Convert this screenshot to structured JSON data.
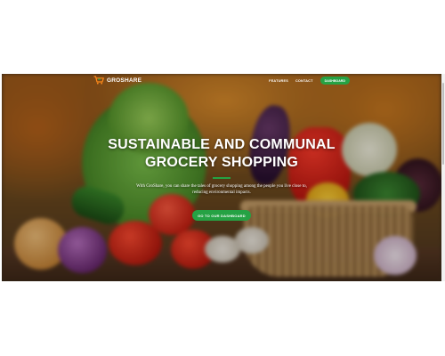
{
  "brand": {
    "name": "GROSHARE",
    "icon": "shopping-cart-icon",
    "accent": "#25a244"
  },
  "nav": {
    "links": [
      "FEATURES",
      "CONTACT"
    ],
    "dashboard_button": "DASHBOARD"
  },
  "hero": {
    "title_line1": "SUSTAINABLE AND COMMUNAL",
    "title_line2": "GROCERY SHOPPING",
    "subtitle": "With GroShare, you can share the tales of grocery shopping among the people you live close to, reducing environmental impacts.",
    "cta": "GO TO OUR DASHBOARD"
  }
}
